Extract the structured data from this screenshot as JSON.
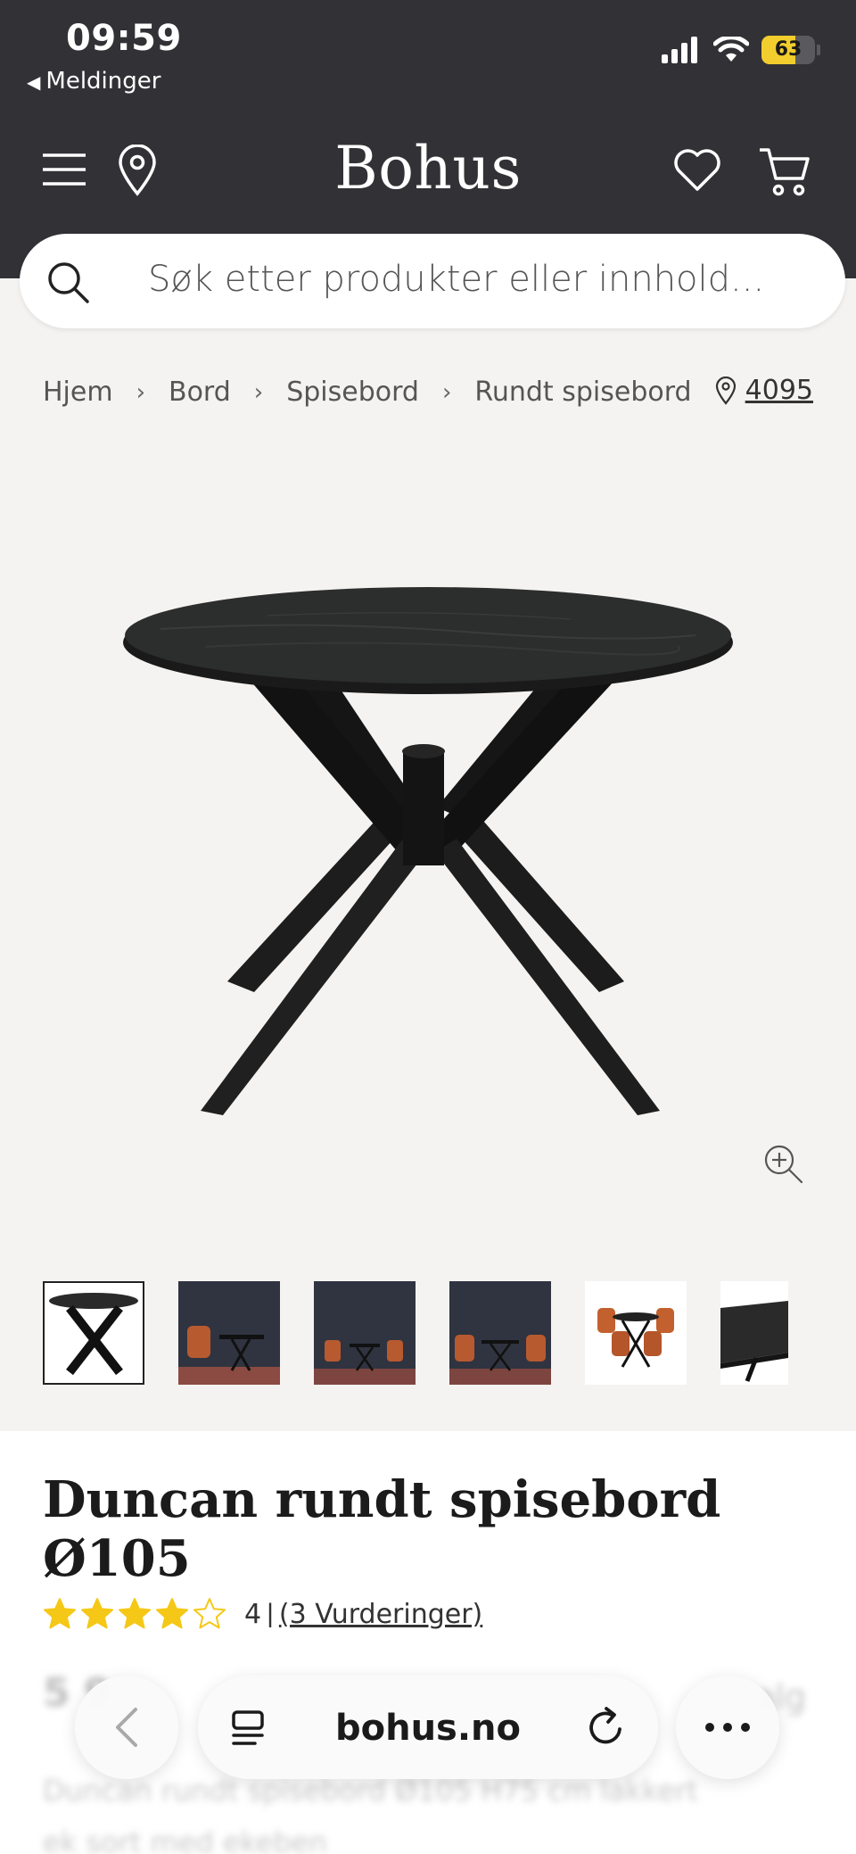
{
  "status_bar": {
    "time": "09:59",
    "back_label": "Meldinger",
    "battery_level": 63,
    "battery_text": "63"
  },
  "header": {
    "brand": "Bohus",
    "icons": [
      "menu-icon",
      "location-pin-icon",
      "heart-icon",
      "cart-icon"
    ]
  },
  "search": {
    "placeholder": "Søk etter produkter eller innhold..."
  },
  "breadcrumb": {
    "items": [
      "Hjem",
      "Bord",
      "Spisebord",
      "Rundt spisebord"
    ],
    "store_code": "4095"
  },
  "gallery": {
    "selected_index": 0,
    "thumbnail_count": 6
  },
  "product": {
    "title": "Duncan rundt spisebord Ø105",
    "rating": 4,
    "rating_max": 5,
    "rating_text": "4",
    "reviews_text": "(3 Vurderinger)"
  },
  "obscured": {
    "price_text": "5 9",
    "status_text": "alg",
    "desc_line1": "Duncan rundt spisebord Ø105 H75 cm lakkert",
    "desc_line2": "ek sort med ekeben"
  },
  "browser": {
    "url": "bohus.no"
  },
  "colors": {
    "header_bg": "#323236",
    "page_bg": "#f5f3f1",
    "star": "#f5c817",
    "battery": "#f2cd2e"
  }
}
